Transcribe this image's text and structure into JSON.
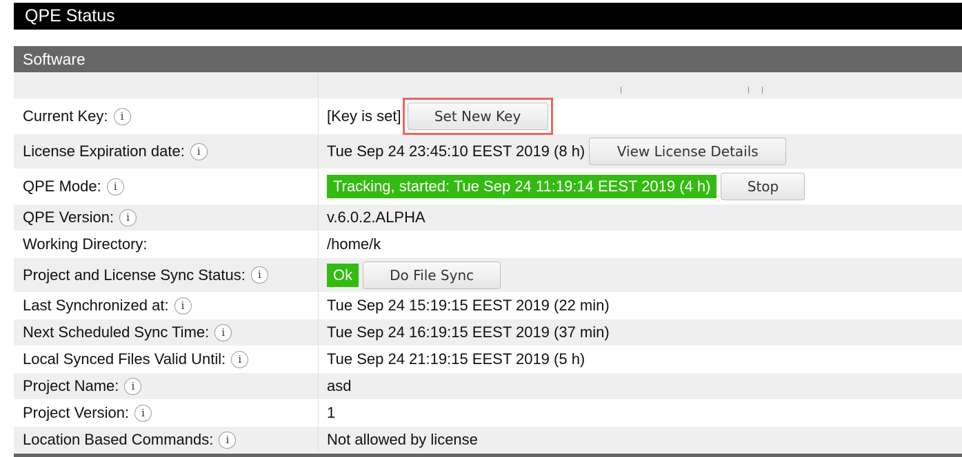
{
  "title": "QPE Status",
  "section": "Software",
  "rows": [
    {
      "label": "Current Key:",
      "value": "[Key is set]",
      "button": "Set New Key"
    },
    {
      "label": "License Expiration date:",
      "value": "Tue Sep 24 23:45:10 EEST 2019 (8 h)",
      "button": "View License Details"
    },
    {
      "label": "QPE Mode:",
      "value": "Tracking, started: Tue Sep 24 11:19:14 EEST 2019 (4 h)",
      "button": "Stop"
    },
    {
      "label": "QPE Version:",
      "value": "v.6.0.2.ALPHA"
    },
    {
      "label": "Working Directory:",
      "value": "/home/k"
    },
    {
      "label": "Project and License Sync Status:",
      "value": "Ok",
      "button": "Do File Sync"
    },
    {
      "label": "Last Synchronized at:",
      "value": "Tue Sep 24 15:19:15 EEST 2019 (22 min)"
    },
    {
      "label": "Next Scheduled Sync Time:",
      "value": "Tue Sep 24 16:19:15 EEST 2019 (37 min)"
    },
    {
      "label": "Local Synced Files Valid Until:",
      "value": "Tue Sep 24 21:19:15 EEST 2019 (5 h)"
    },
    {
      "label": "Project Name:",
      "value": "asd"
    },
    {
      "label": "Project Version:",
      "value": "1"
    },
    {
      "label": "Location Based Commands:",
      "value": "Not allowed by license"
    }
  ],
  "info_icon_glyph": "i",
  "colors": {
    "title_bg": "#000000",
    "section_bg": "#666666",
    "status_green": "#33bb11",
    "highlight": "#f0645a"
  }
}
